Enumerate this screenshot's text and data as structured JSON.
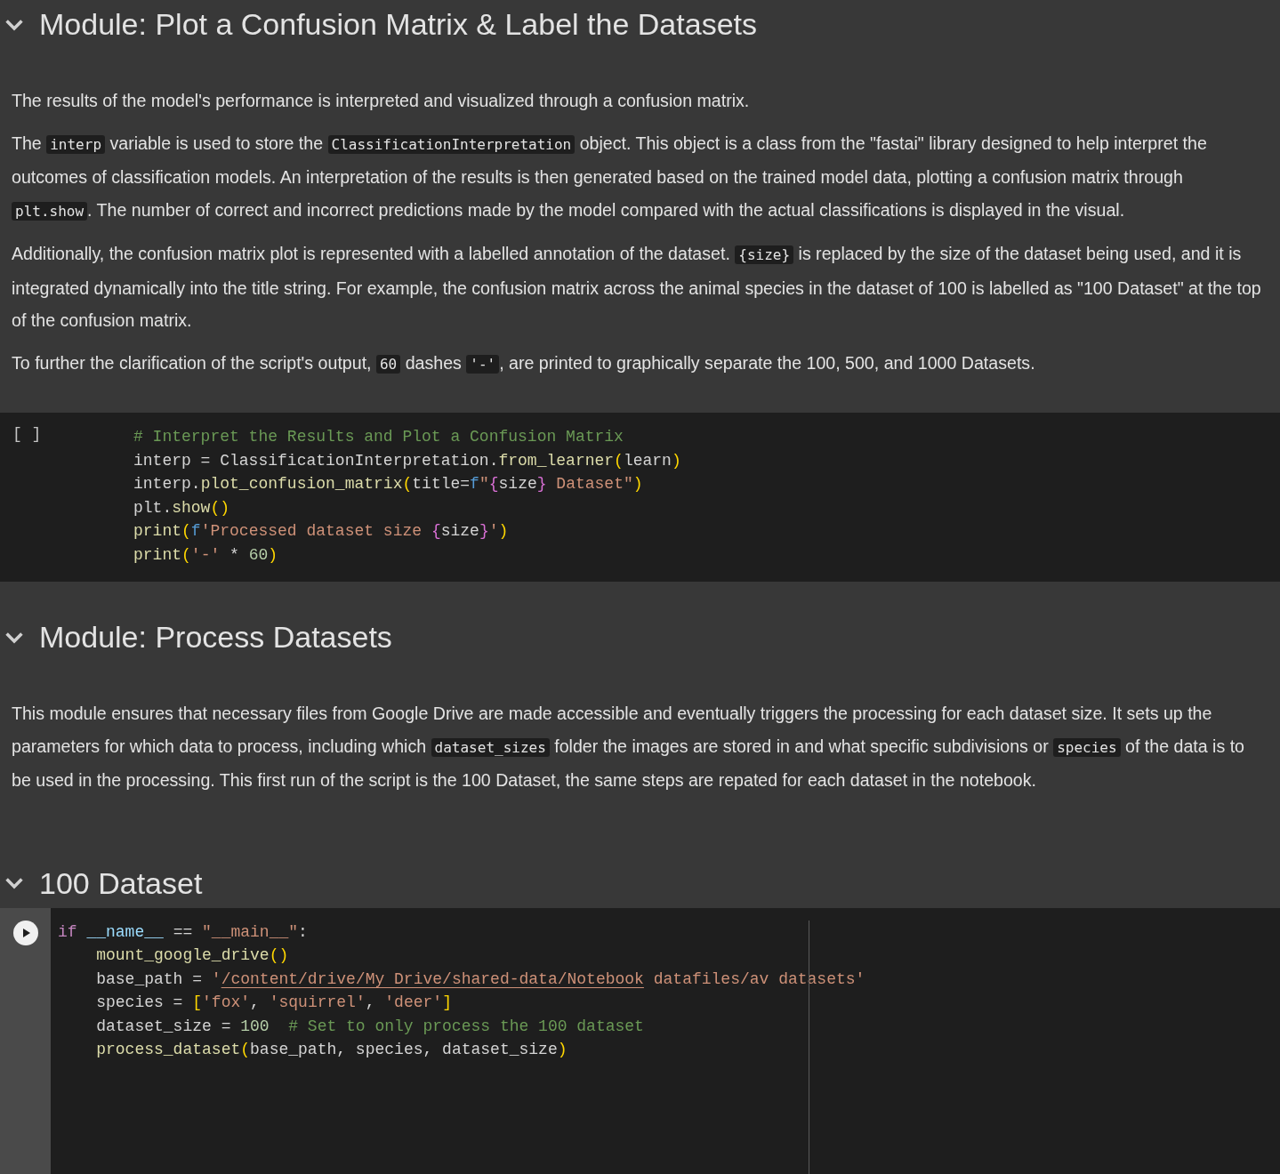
{
  "sections": [
    {
      "kind": "heading",
      "expanded": true,
      "title": "Module: Plot a Confusion Matrix & Label the Datasets"
    },
    {
      "kind": "text",
      "paragraphs": [
        [
          {
            "kind": "text",
            "text": "The results of the model's performance is interpreted and visualized through a confusion matrix."
          }
        ],
        [
          {
            "kind": "text",
            "text": "The "
          },
          {
            "kind": "code",
            "text": "interp"
          },
          {
            "kind": "text",
            "text": " variable is used to store the "
          },
          {
            "kind": "code",
            "text": "ClassificationInterpretation"
          },
          {
            "kind": "text",
            "text": " object. This object is a class from the \"fastai\" library designed to help interpret the outcomes of classification models. An interpretation of the results is then generated based on the trained model data, plotting a confusion matrix through "
          },
          {
            "kind": "code",
            "text": "plt.show"
          },
          {
            "kind": "text",
            "text": ". The number of correct and incorrect predictions made by the model compared with the actual classifications is displayed in the visual."
          }
        ],
        [
          {
            "kind": "text",
            "text": "Additionally, the confusion matrix plot is represented with a labelled annotation of the dataset. "
          },
          {
            "kind": "code",
            "text": "{size}"
          },
          {
            "kind": "text",
            "text": " is replaced by the size of the dataset being used, and it is integrated dynamically into the title string. For example, the confusion matrix across the animal species in the dataset of 100 is labelled as \"100 Dataset\" at the top of the confusion matrix."
          }
        ],
        [
          {
            "kind": "text",
            "text": "To further the clarification of the script's output, "
          },
          {
            "kind": "code",
            "text": "60"
          },
          {
            "kind": "text",
            "text": " dashes "
          },
          {
            "kind": "code",
            "text": "'-'"
          },
          {
            "kind": "text",
            "text": ", are printed to graphically separate the 100, 500, and 1000 Datasets."
          }
        ]
      ]
    },
    {
      "kind": "code",
      "execution": "[ ]",
      "lines": [
        [
          {
            "kind": "comment",
            "text": "# Interpret the Results and Plot a Confusion Matrix"
          }
        ],
        [
          {
            "kind": "plain",
            "text": "interp = ClassificationInterpretation."
          },
          {
            "kind": "func",
            "text": "from_learner"
          },
          {
            "kind": "paren",
            "text": "("
          },
          {
            "kind": "plain",
            "text": "learn"
          },
          {
            "kind": "paren",
            "text": ")"
          }
        ],
        [
          {
            "kind": "plain",
            "text": "interp."
          },
          {
            "kind": "func",
            "text": "plot_confusion_matrix"
          },
          {
            "kind": "paren",
            "text": "("
          },
          {
            "kind": "plain",
            "text": "title="
          },
          {
            "kind": "prefix",
            "text": "f"
          },
          {
            "kind": "string",
            "text": "\""
          },
          {
            "kind": "brace",
            "text": "{"
          },
          {
            "kind": "plain",
            "text": "size"
          },
          {
            "kind": "brace",
            "text": "}"
          },
          {
            "kind": "string",
            "text": " Dataset\""
          },
          {
            "kind": "paren",
            "text": ")"
          }
        ],
        [
          {
            "kind": "plain",
            "text": "plt."
          },
          {
            "kind": "func",
            "text": "show"
          },
          {
            "kind": "paren",
            "text": "()"
          }
        ],
        [
          {
            "kind": "func",
            "text": "print"
          },
          {
            "kind": "paren",
            "text": "("
          },
          {
            "kind": "prefix",
            "text": "f"
          },
          {
            "kind": "string",
            "text": "'Processed dataset size "
          },
          {
            "kind": "brace",
            "text": "{"
          },
          {
            "kind": "plain",
            "text": "size"
          },
          {
            "kind": "brace",
            "text": "}"
          },
          {
            "kind": "string",
            "text": "'"
          },
          {
            "kind": "paren",
            "text": ")"
          }
        ],
        [
          {
            "kind": "func",
            "text": "print"
          },
          {
            "kind": "paren",
            "text": "("
          },
          {
            "kind": "string",
            "text": "'-'"
          },
          {
            "kind": "plain",
            "text": " * "
          },
          {
            "kind": "number",
            "text": "60"
          },
          {
            "kind": "paren",
            "text": ")"
          }
        ]
      ]
    },
    {
      "kind": "heading",
      "expanded": true,
      "title": "Module: Process Datasets"
    },
    {
      "kind": "text",
      "paragraphs": [
        [
          {
            "kind": "text",
            "text": "This module ensures that necessary files from Google Drive are made accessible and eventually triggers the processing for each dataset size. It sets up the parameters for which data to process, including which "
          },
          {
            "kind": "code",
            "text": "dataset_sizes"
          },
          {
            "kind": "text",
            "text": " folder the images are stored in and what specific subdivisions or "
          },
          {
            "kind": "code",
            "text": "species"
          },
          {
            "kind": "text",
            "text": " of the data is to be used in the processing. This first run of the script is the 100 Dataset, the same steps are repated for each dataset in the notebook."
          }
        ]
      ]
    },
    {
      "kind": "heading",
      "expanded": true,
      "title": "100 Dataset"
    },
    {
      "kind": "code",
      "run_button": true,
      "ruler": true,
      "lines": [
        [
          {
            "kind": "keyword",
            "text": "if "
          },
          {
            "kind": "variable",
            "text": "__name__"
          },
          {
            "kind": "plain",
            "text": " == "
          },
          {
            "kind": "string",
            "text": "\"__main__\""
          },
          {
            "kind": "plain",
            "text": ":"
          }
        ],
        [
          {
            "kind": "func",
            "text": "    mount_google_drive"
          },
          {
            "kind": "paren",
            "text": "()"
          }
        ],
        [
          {
            "kind": "plain",
            "text": "    base_path = "
          },
          {
            "kind": "string",
            "text": "'"
          },
          {
            "kind": "link",
            "text": "/content/drive/My Drive/shared-data/Notebook"
          },
          {
            "kind": "string",
            "text": " datafiles/av datasets'"
          }
        ],
        [
          {
            "kind": "plain",
            "text": "    species = "
          },
          {
            "kind": "paren",
            "text": "["
          },
          {
            "kind": "string",
            "text": "'fox'"
          },
          {
            "kind": "plain",
            "text": ", "
          },
          {
            "kind": "string",
            "text": "'squirrel'"
          },
          {
            "kind": "plain",
            "text": ", "
          },
          {
            "kind": "string",
            "text": "'deer'"
          },
          {
            "kind": "paren",
            "text": "]"
          }
        ],
        [
          {
            "kind": "plain",
            "text": "    dataset_size = "
          },
          {
            "kind": "number",
            "text": "100"
          },
          {
            "kind": "comment",
            "text": "  # Set to only process the 100 dataset"
          }
        ],
        [
          {
            "kind": "func",
            "text": "    process_dataset"
          },
          {
            "kind": "paren",
            "text": "("
          },
          {
            "kind": "plain",
            "text": "base_path, species, dataset_size"
          },
          {
            "kind": "paren",
            "text": ")"
          }
        ]
      ]
    }
  ]
}
